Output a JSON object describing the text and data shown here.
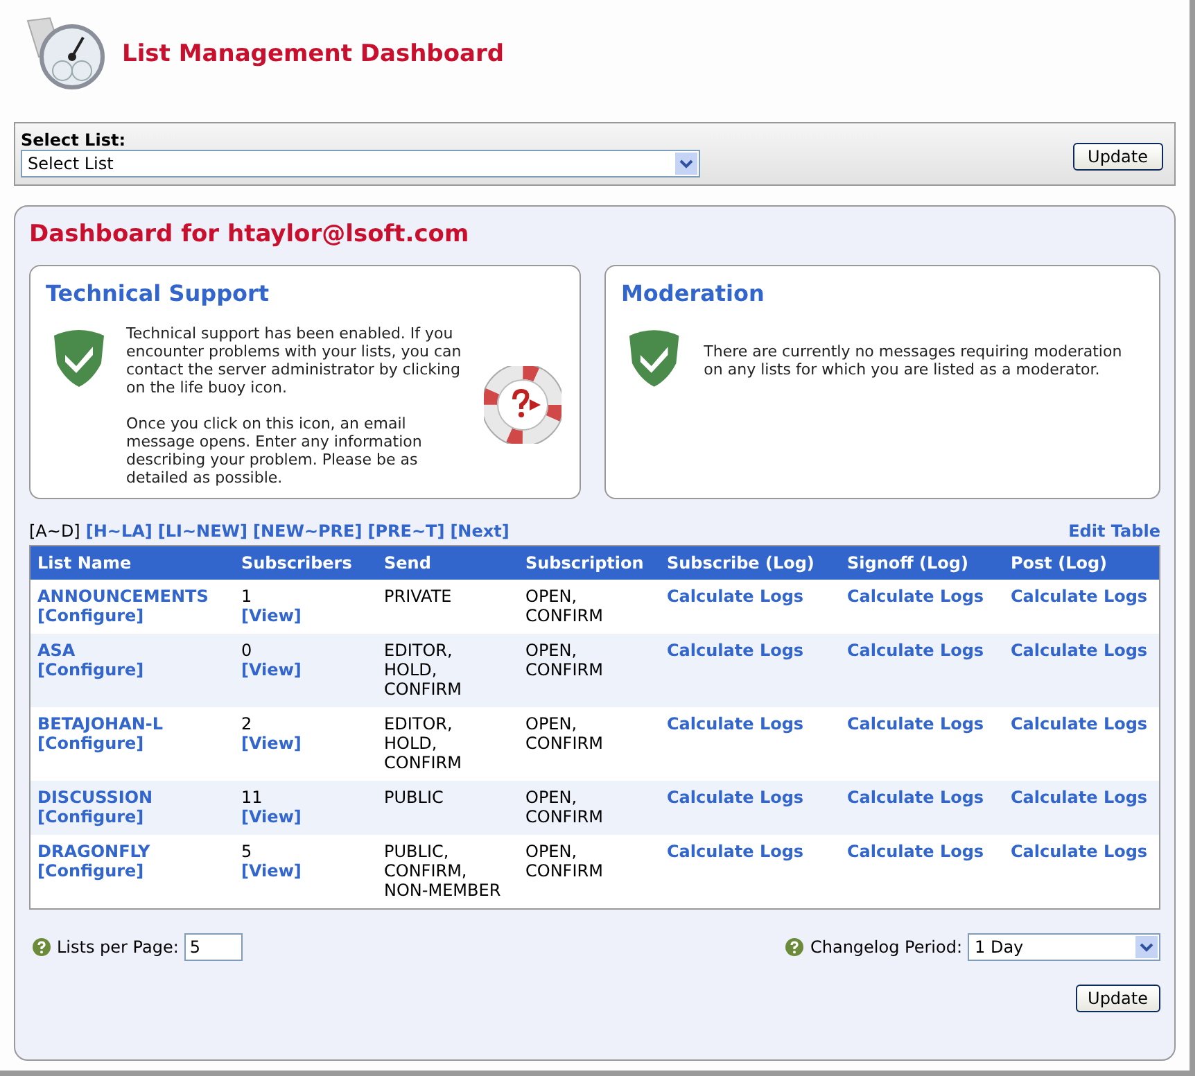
{
  "header": {
    "title": "List Management Dashboard"
  },
  "select_list": {
    "label": "Select List:",
    "value": "Select List",
    "button": "Update"
  },
  "dashboard": {
    "title": "Dashboard for htaylor@lsoft.com",
    "technical_support": {
      "title": "Technical Support",
      "paragraphs": [
        "Technical support has been enabled. If you encounter problems with your lists, you can contact the server administrator by clicking on the life buoy icon.",
        "Once you click on this icon, an email message opens. Enter any information describing your problem. Please be as detailed as possible."
      ]
    },
    "moderation": {
      "title": "Moderation",
      "text": "There are currently no messages requiring moderation on any lists for which you are listed as a moderator."
    },
    "pages": [
      {
        "label": "[A~D]",
        "selected": true
      },
      {
        "label": "[H~LA]",
        "selected": false
      },
      {
        "label": "[LI~NEW]",
        "selected": false
      },
      {
        "label": "[NEW~PRE]",
        "selected": false
      },
      {
        "label": "[PRE~T]",
        "selected": false
      },
      {
        "label": "[Next]",
        "selected": false
      }
    ],
    "edit_table": "Edit Table",
    "table": {
      "columns": [
        "List Name",
        "Subscribers",
        "Send",
        "Subscription",
        "Subscribe (Log)",
        "Signoff (Log)",
        "Post (Log)"
      ],
      "rows": [
        {
          "name": "ANNOUNCEMENTS",
          "configure": "[Configure]",
          "subscribers": "1",
          "view": "[View]",
          "send": [
            "PRIVATE"
          ],
          "subscription": [
            "OPEN,",
            "CONFIRM"
          ],
          "logs": [
            "Calculate Logs",
            "Calculate Logs",
            "Calculate Logs"
          ]
        },
        {
          "name": "ASA",
          "configure": "[Configure]",
          "subscribers": "0",
          "view": "[View]",
          "send": [
            "EDITOR,",
            "HOLD,",
            "CONFIRM"
          ],
          "subscription": [
            "OPEN,",
            "CONFIRM"
          ],
          "logs": [
            "Calculate Logs",
            "Calculate Logs",
            "Calculate Logs"
          ]
        },
        {
          "name": "BETAJOHAN-L",
          "configure": "[Configure]",
          "subscribers": "2",
          "view": "[View]",
          "send": [
            "EDITOR,",
            "HOLD,",
            "CONFIRM"
          ],
          "subscription": [
            "OPEN,",
            "CONFIRM"
          ],
          "logs": [
            "Calculate Logs",
            "Calculate Logs",
            "Calculate Logs"
          ]
        },
        {
          "name": "DISCUSSION",
          "configure": "[Configure]",
          "subscribers": "11",
          "view": "[View]",
          "send": [
            "PUBLIC"
          ],
          "subscription": [
            "OPEN,",
            "CONFIRM"
          ],
          "logs": [
            "Calculate Logs",
            "Calculate Logs",
            "Calculate Logs"
          ]
        },
        {
          "name": "DRAGONFLY",
          "configure": "[Configure]",
          "subscribers": "5",
          "view": "[View]",
          "send": [
            "PUBLIC,",
            "CONFIRM,",
            "NON-MEMBER"
          ],
          "subscription": [
            "OPEN,",
            "CONFIRM"
          ],
          "logs": [
            "Calculate Logs",
            "Calculate Logs",
            "Calculate Logs"
          ]
        }
      ]
    },
    "lists_per_page": {
      "label": "Lists per Page:",
      "value": "5"
    },
    "changelog_period": {
      "label": "Changelog Period:",
      "value": "1 Day"
    },
    "update_button": "Update"
  }
}
